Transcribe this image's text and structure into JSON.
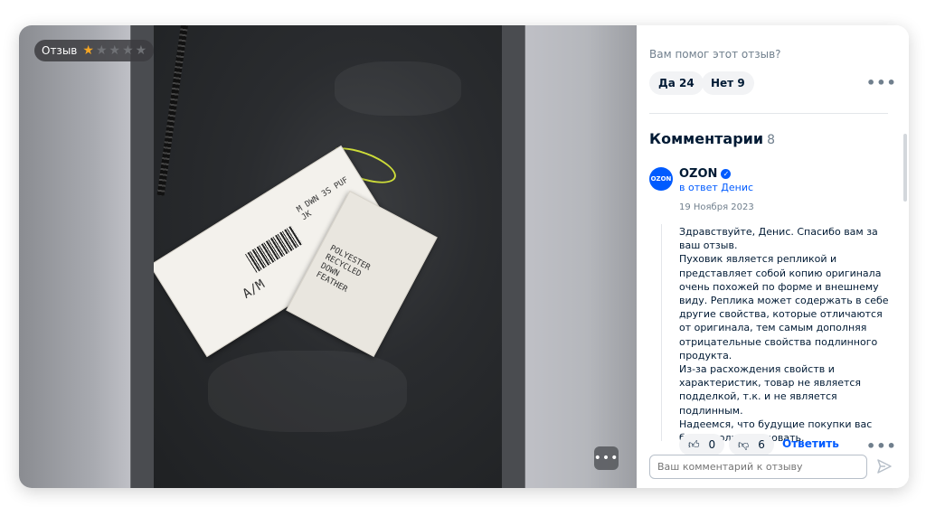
{
  "media": {
    "badge_label": "Отзыв",
    "rating": 1,
    "rating_max": 5,
    "more_label": "•••"
  },
  "helpful": {
    "question": "Вам помог этот отзыв?",
    "yes_label": "Да 24",
    "no_label": "Нет 9"
  },
  "comments": {
    "title": "Комментарии",
    "count": "8",
    "item": {
      "avatar_text": "OZON",
      "author": "OZON",
      "reply_to": "в ответ Денис",
      "date": "19 Ноября 2023",
      "text": [
        "Здравствуйте, Денис. Спасибо вам за ваш отзыв.",
        "Пуховик является репликой и представляет собой копию оригинала очень похожей по форме и внешнему виду. Реплика может содержать в себе другие свойства, которые отличаются от оригинала, тем самым дополняя отрицательные свойства подлинного продукта.",
        "Из-за расхождения свойств и характеристик, товар не является подделкой, т.к. и не является подлинным.",
        "Надеемся, что будущие покупки вас будут только радовать."
      ],
      "likes": "0",
      "dislikes": "6",
      "reply_label": "Ответить"
    }
  },
  "input": {
    "placeholder": "Ваш комментарий к отзыву"
  },
  "colors": {
    "accent": "#005bff",
    "star": "#f5a623"
  }
}
